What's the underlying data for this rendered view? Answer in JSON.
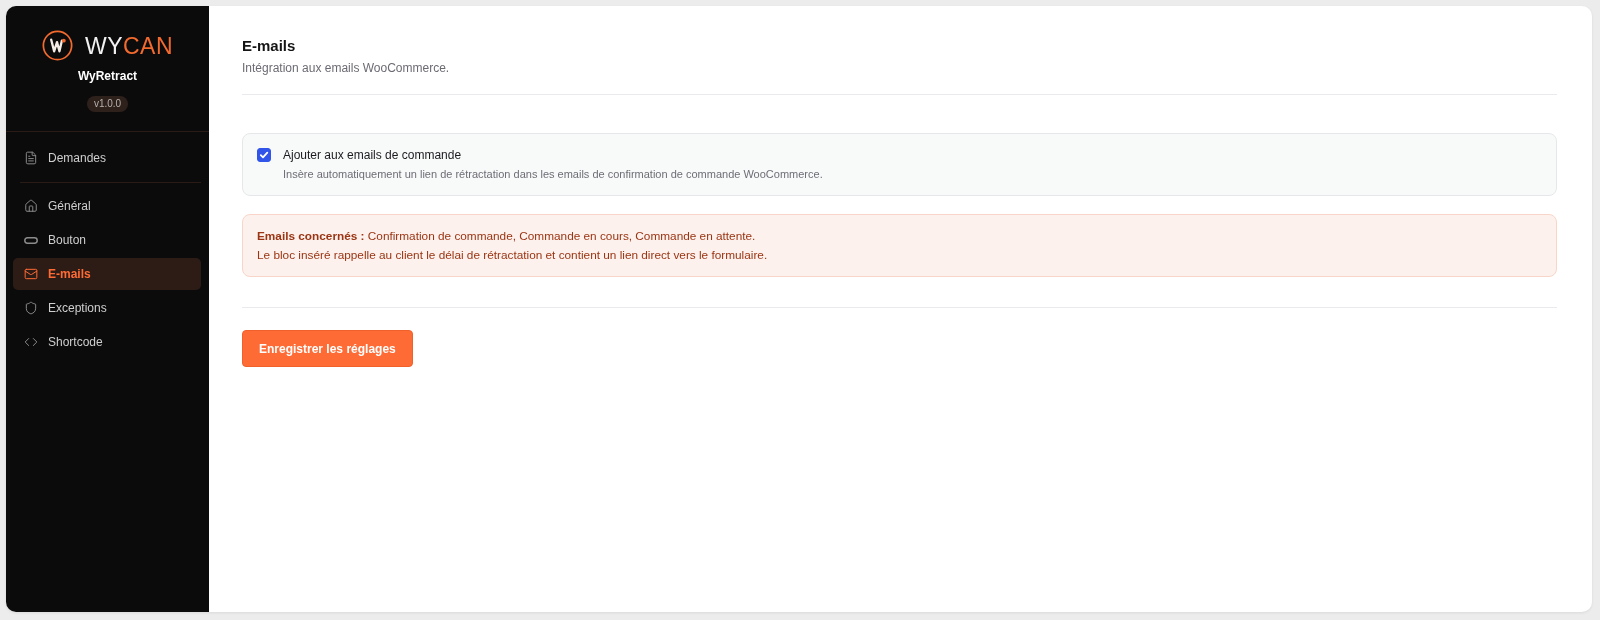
{
  "sidebar": {
    "logo": {
      "wordmark": [
        {
          "text": "WY",
          "accent": false
        },
        {
          "text": "CAN",
          "accent": true
        }
      ]
    },
    "app_name": "WyRetract",
    "version": "v1.0.0",
    "nav_sections": [
      {
        "items": [
          {
            "label": "Demandes",
            "selected": false
          }
        ]
      },
      {
        "items": [
          {
            "label": "Général",
            "selected": false
          },
          {
            "label": "Bouton",
            "selected": false
          },
          {
            "label": "E-mails",
            "selected": true
          },
          {
            "label": "Exceptions",
            "selected": false
          },
          {
            "label": "Shortcode",
            "selected": false
          }
        ]
      }
    ]
  },
  "main": {
    "title": "E-mails",
    "subtitle": "Intégration aux emails WooCommerce.",
    "option": {
      "checked": true,
      "label": "Ajouter aux emails de commande",
      "description": "Insère automatiquement un lien de rétractation dans les emails de confirmation de commande WooCommerce."
    },
    "notice": {
      "lines": [
        "**Emails concernés :** Confirmation de commande, Commande en cours, Commande en attente.",
        "Le bloc inséré rappelle au client le délai de rétractation et contient un lien direct vers le formulaire."
      ]
    },
    "save_button": "Enregistrer les réglages"
  }
}
